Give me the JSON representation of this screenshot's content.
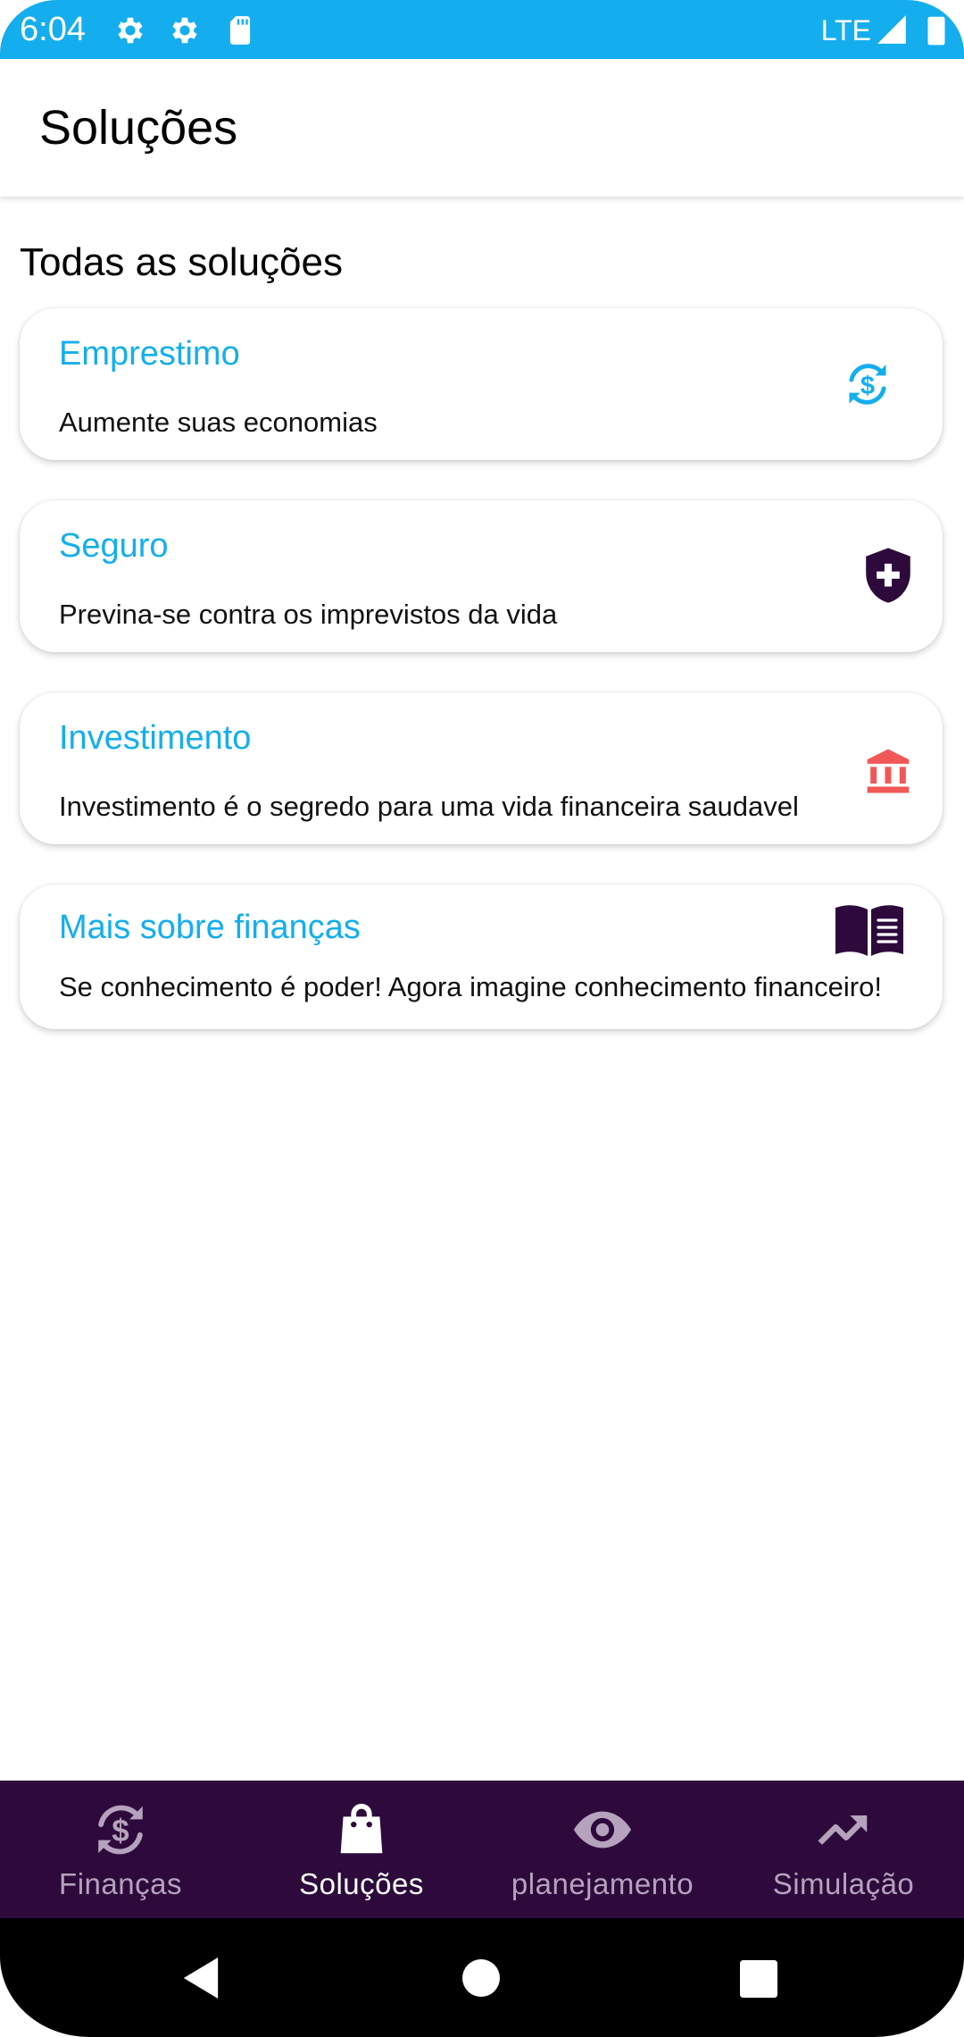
{
  "status_bar": {
    "time": "6:04",
    "network": "LTE",
    "icons": [
      "gear-icon",
      "gear-icon",
      "sd-card-icon",
      "signal-icon",
      "battery-icon"
    ]
  },
  "app_bar": {
    "title": "Soluções"
  },
  "section": {
    "title": "Todas as soluções"
  },
  "cards": [
    {
      "title": "Emprestimo",
      "description": "Aumente suas economias",
      "icon": "currency-exchange-icon",
      "icon_color": "#14aeee"
    },
    {
      "title": "Seguro",
      "description": "Previna-se contra os imprevistos da vida",
      "icon": "shield-plus-icon",
      "icon_color": "#2d0a3b"
    },
    {
      "title": "Investimento",
      "description": "Investimento é o segredo para uma vida financeira saudavel",
      "icon": "bank-icon",
      "icon_color": "#f25757"
    },
    {
      "title": "Mais sobre finanças",
      "description": "Se conhecimento é poder! Agora imagine conhecimento financeiro!",
      "icon": "book-open-icon",
      "icon_color": "#2d0a3b"
    }
  ],
  "bottom_nav": {
    "items": [
      {
        "label": "Finanças",
        "icon": "currency-exchange-icon",
        "active": false
      },
      {
        "label": "Soluções",
        "icon": "shopping-bag-icon",
        "active": true
      },
      {
        "label": "planejamento",
        "icon": "eye-icon",
        "active": false
      },
      {
        "label": "Simulação",
        "icon": "trending-up-icon",
        "active": false
      }
    ]
  },
  "system_nav": {
    "buttons": [
      "back-icon",
      "home-icon",
      "recents-icon"
    ]
  },
  "colors": {
    "status_bar": "#14aeee",
    "accent": "#14aeee",
    "bottom_nav_bg": "#2d0a3b",
    "nav_inactive": "#b5a2bd",
    "nav_active": "#ffffff"
  }
}
